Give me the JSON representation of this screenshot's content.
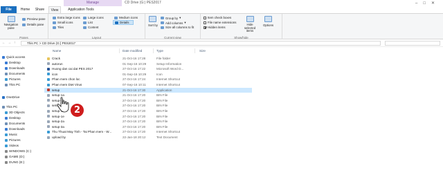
{
  "window": {
    "title": "CD Drive (G:) PES2017",
    "contextual_band": "Manage"
  },
  "tabs": {
    "file": "File",
    "home": "Home",
    "share": "Share",
    "view": "View",
    "apptools": "Application Tools"
  },
  "ribbon": {
    "panes": {
      "label": "Panes",
      "nav_pane": "Navigation pane",
      "preview": "Preview pane",
      "details": "Details pane"
    },
    "layout": {
      "label": "Layout",
      "items": [
        "Extra large icons",
        "Large icons",
        "Medium icons",
        "Small icons",
        "List",
        "Details",
        "Tiles",
        "Content"
      ]
    },
    "current_view": {
      "label": "Current view",
      "sort_by": "Sort by",
      "group_by": "Group by",
      "add_columns": "Add columns",
      "size_all": "Size all columns to fit"
    },
    "show_hide": {
      "label": "Show/hide",
      "item_check_boxes": "Item check boxes",
      "file_name_extensions": "File name extensions",
      "hidden_items": "Hidden items",
      "hide_selected": "Hide selected items",
      "options": "Options"
    }
  },
  "address": {
    "path": "This PC  >  CD Drive (G:) PES2017",
    "back": "←",
    "forward": "→",
    "up": "↑"
  },
  "nav": {
    "items": [
      {
        "label": "Quick access",
        "color": "#3a7bd5"
      },
      {
        "label": "Desktop",
        "color": "#3a7bd5"
      },
      {
        "label": "Downloads",
        "color": "#3a7bd5"
      },
      {
        "label": "Documents",
        "color": "#6f8fb5"
      },
      {
        "label": "Pictures",
        "color": "#3a9bd5"
      },
      {
        "label": "This PC",
        "color": "#6f8fb5"
      },
      {
        "label": "OneDrive",
        "color": "#2b73c7"
      },
      {
        "label": "This PC",
        "color": "#6f8fb5"
      },
      {
        "label": "3D Objects",
        "color": "#3a9bd5"
      },
      {
        "label": "Desktop",
        "color": "#3a7bd5"
      },
      {
        "label": "Documents",
        "color": "#6f8fb5"
      },
      {
        "label": "Downloads",
        "color": "#3a7bd5"
      },
      {
        "label": "Music",
        "color": "#3a9bd5"
      },
      {
        "label": "Pictures",
        "color": "#3a9bd5"
      },
      {
        "label": "Videos",
        "color": "#3a9bd5"
      },
      {
        "label": "WINDOWS (C:)",
        "color": "#888888"
      },
      {
        "label": "GAME (D:)",
        "color": "#888888"
      },
      {
        "label": "DUNG (E:)",
        "color": "#888888"
      }
    ]
  },
  "columns": {
    "name": "Name",
    "date": "Date modified",
    "type": "Type",
    "size": "Size"
  },
  "files": [
    {
      "name": "Crack",
      "date": "21-Oct-16 17:28",
      "type": "File folder",
      "size": "",
      "color": "#e8c45a"
    },
    {
      "name": "autorun",
      "date": "01-Sep-16 10:29",
      "type": "Setup Information",
      "size": "",
      "color": "#9aa7b8"
    },
    {
      "name": "Huong dan cai dat PES 2017",
      "date": "27-Oct-16 17:22",
      "type": "Microsoft Word D...",
      "size": "",
      "color": "#2b5797"
    },
    {
      "name": "icon",
      "date": "01-Sep-16 10:29",
      "type": "Icon",
      "size": "",
      "color": "#3a9bd5"
    },
    {
      "name": "Phan mem chon loc",
      "date": "27-Oct-16 17:24",
      "type": "Internet Shortcut",
      "size": "",
      "color": "#3a9bd5"
    },
    {
      "name": "Phan mem Diet Virus",
      "date": "07-Sep-16 10:11",
      "type": "Internet Shortcut",
      "size": "",
      "color": "#3a9bd5"
    },
    {
      "name": "setup",
      "date": "21-Oct-16 17:30",
      "type": "Application",
      "size": "",
      "color": "#c0392b",
      "selected": true
    },
    {
      "name": "setup-1a",
      "date": "21-Oct-16 17:20",
      "type": "BIN File",
      "size": "",
      "color": "#9aa7b8"
    },
    {
      "name": "setup-1b",
      "date": "27-Oct-16 17:20",
      "type": "BIN File",
      "size": "",
      "color": "#9aa7b8"
    },
    {
      "name": "setup-1c",
      "date": "27-Oct-16 17:20",
      "type": "BIN File",
      "size": "",
      "color": "#9aa7b8"
    },
    {
      "name": "setup-1d",
      "date": "27-Oct-16 17:20",
      "type": "BIN File",
      "size": "",
      "color": "#9aa7b8"
    },
    {
      "name": "setup-1e",
      "date": "27-Oct-16 17:20",
      "type": "BIN File",
      "size": "",
      "color": "#9aa7b8"
    },
    {
      "name": "setup-2a",
      "date": "27-Oct-16 17:20",
      "type": "BIN File",
      "size": "",
      "color": "#9aa7b8"
    },
    {
      "name": "setup-3a",
      "date": "27-Oct-16 17:20",
      "type": "BIN File",
      "size": "",
      "color": "#9aa7b8"
    },
    {
      "name": "Thu Thuat May Tinh - Tai Phan mem - W...",
      "date": "27-Oct-16 17:20",
      "type": "Internet Shortcut",
      "size": "",
      "color": "#3a9bd5"
    },
    {
      "name": "upload by",
      "date": "22-Jan-18 20:12",
      "type": "Text Document",
      "size": "",
      "color": "#9aa7b8"
    }
  ],
  "annotation": {
    "step": "2",
    "color": "#cf1d1d"
  }
}
